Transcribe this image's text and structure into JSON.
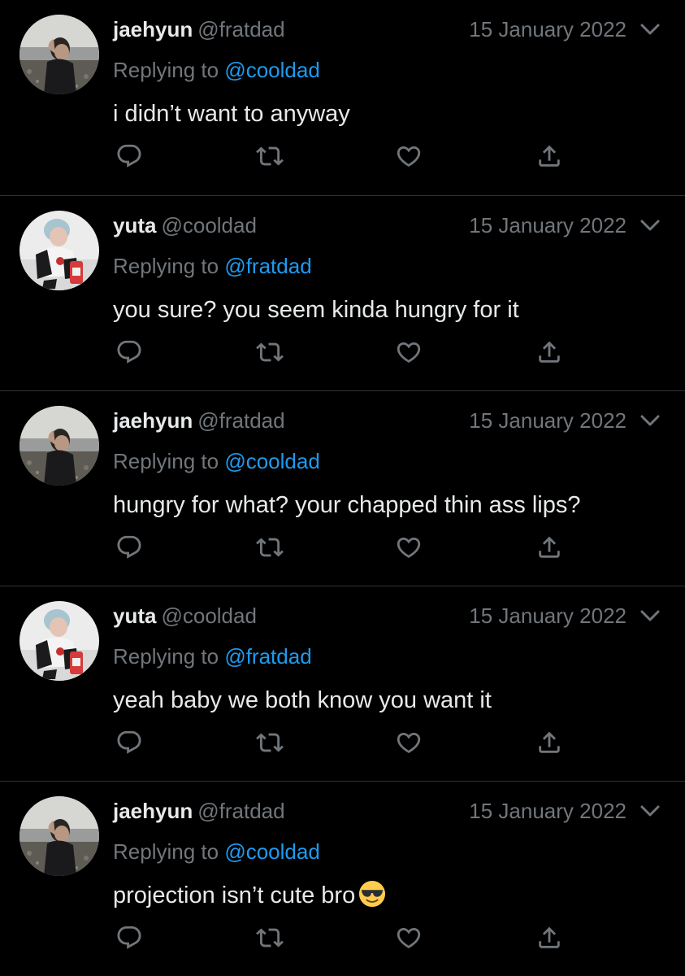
{
  "colors": {
    "background": "#000000",
    "text": "#E7E9EA",
    "muted": "#71767B",
    "link": "#1D9BF0",
    "divider": "#2F3336"
  },
  "tweets": [
    {
      "avatar": "avatar-jaehyun",
      "name": "jaehyun",
      "handle": "@fratdad",
      "date": "15 January 2022",
      "replying_prefix": "Replying to",
      "replying_to": "@cooldad",
      "text": "i didn’t want to anyway"
    },
    {
      "avatar": "avatar-yuta",
      "name": "yuta",
      "handle": "@cooldad",
      "date": "15 January 2022",
      "replying_prefix": "Replying to",
      "replying_to": "@fratdad",
      "text": "you sure? you seem kinda hungry for it"
    },
    {
      "avatar": "avatar-jaehyun",
      "name": "jaehyun",
      "handle": "@fratdad",
      "date": "15 January 2022",
      "replying_prefix": "Replying to",
      "replying_to": "@cooldad",
      "text": "hungry for what? your chapped thin ass lips?"
    },
    {
      "avatar": "avatar-yuta",
      "name": "yuta",
      "handle": "@cooldad",
      "date": "15 January 2022",
      "replying_prefix": "Replying to",
      "replying_to": "@fratdad",
      "text": "yeah baby we both know you want it"
    },
    {
      "avatar": "avatar-jaehyun",
      "name": "jaehyun",
      "handle": "@fratdad",
      "date": "15 January 2022",
      "replying_prefix": "Replying to",
      "replying_to": "@cooldad",
      "text": "projection isn’t cute bro",
      "emoji": "sunglasses-emoji"
    }
  ],
  "icons": {
    "reply": "reply-icon",
    "retweet": "retweet-icon",
    "like": "heart-icon",
    "share": "share-icon",
    "more": "chevron-down-icon"
  }
}
